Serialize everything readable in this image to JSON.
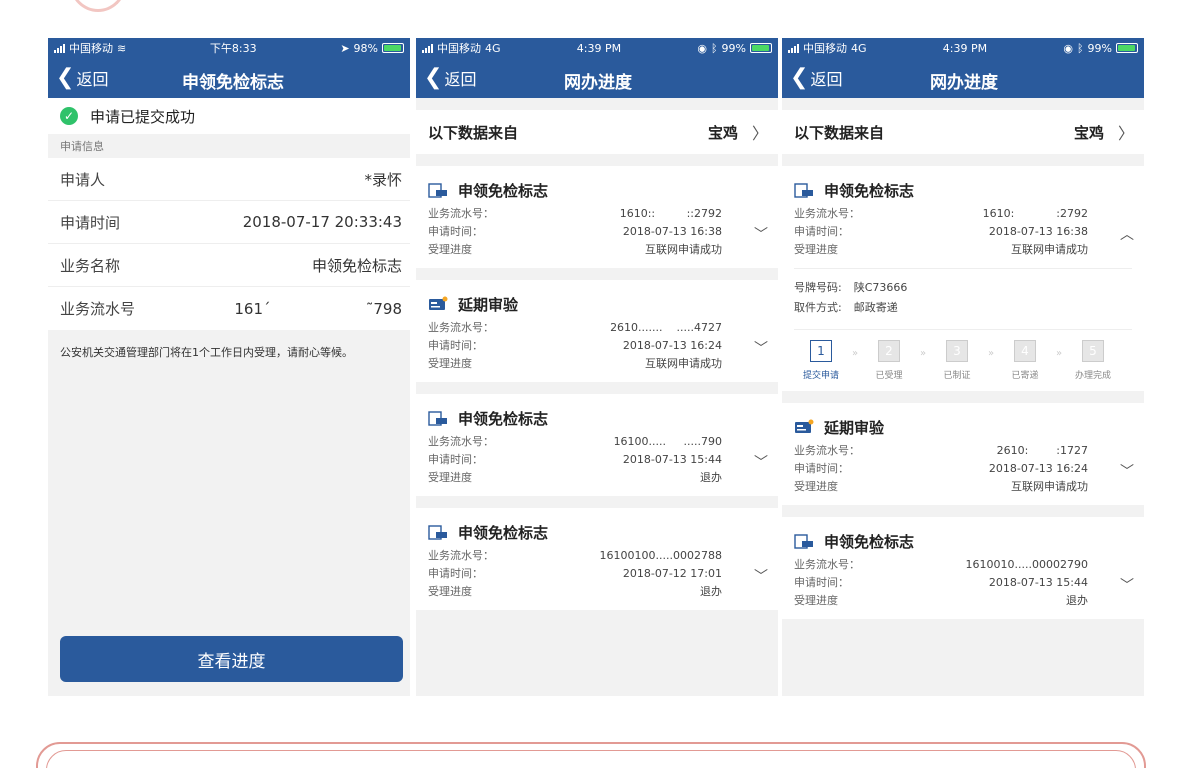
{
  "panel1": {
    "status": {
      "carrier": "中国移动",
      "time": "下午8:33",
      "battery": "98%"
    },
    "nav": {
      "back": "返回",
      "title": "申领免检标志"
    },
    "success": "申请已提交成功",
    "section": "申请信息",
    "rows": [
      {
        "label": "申请人",
        "value": "*录怀"
      },
      {
        "label": "申请时间",
        "value": "2018-07-17 20:33:43"
      },
      {
        "label": "业务名称",
        "value": "申领免检标志"
      },
      {
        "label": "业务流水号",
        "value": "161´                    ˜798"
      }
    ],
    "notice": "公安机关交通管理部门将在1个工作日内受理，请耐心等候。",
    "button": "查看进度"
  },
  "panel2": {
    "status": {
      "carrier": "中国移动",
      "net": "4G",
      "time": "4:39 PM",
      "battery": "99%"
    },
    "nav": {
      "back": "返回",
      "title": "网办进度"
    },
    "source": {
      "label": "以下数据来自",
      "city": "宝鸡"
    },
    "labels": {
      "serial": "业务流水号：",
      "time": "申请时间：",
      "progress": "受理进度"
    },
    "cards": [
      {
        "title": "申领免检标志",
        "icon": "clipboard-icon",
        "serial": "1610::         ::2792",
        "time": "2018-07-13 16:38",
        "progress": "互联网申请成功"
      },
      {
        "title": "延期审验",
        "icon": "id-card-icon",
        "serial": "2610.......    .....4727",
        "time": "2018-07-13 16:24",
        "progress": "互联网申请成功"
      },
      {
        "title": "申领免检标志",
        "icon": "clipboard-icon",
        "serial": "16100.....     .....790",
        "time": "2018-07-13 15:44",
        "progress": "退办"
      },
      {
        "title": "申领免检标志",
        "icon": "clipboard-icon",
        "serial": "16100100.....0002788",
        "time": "2018-07-12 17:01",
        "progress": "退办"
      }
    ]
  },
  "panel3": {
    "status": {
      "carrier": "中国移动",
      "net": "4G",
      "time": "4:39 PM",
      "battery": "99%"
    },
    "nav": {
      "back": "返回",
      "title": "网办进度"
    },
    "source": {
      "label": "以下数据来自",
      "city": "宝鸡"
    },
    "labels": {
      "serial": "业务流水号：",
      "time": "申请时间：",
      "progress": "受理进度"
    },
    "expanded": {
      "title": "申领免检标志",
      "serial": "1610:            :2792",
      "time": "2018-07-13 16:38",
      "progress": "互联网申请成功",
      "plate_label": "号牌号码:",
      "plate": "陕C73666",
      "pickup_label": "取件方式:",
      "pickup": "邮政寄递",
      "steps": [
        {
          "num": "1",
          "label": "提交申请"
        },
        {
          "num": "2",
          "label": "已受理"
        },
        {
          "num": "3",
          "label": "已制证"
        },
        {
          "num": "4",
          "label": "已寄递"
        },
        {
          "num": "5",
          "label": "办理完成"
        }
      ]
    },
    "cards": [
      {
        "title": "延期审验",
        "serial": "2610:        :1727",
        "time": "2018-07-13 16:24",
        "progress": "互联网申请成功"
      },
      {
        "title": "申领免检标志",
        "serial": "1610010.....00002790",
        "time": "2018-07-13 15:44",
        "progress": "退办"
      }
    ]
  },
  "colors": {
    "primary": "#2a5a9c",
    "success": "#2fc26a"
  }
}
